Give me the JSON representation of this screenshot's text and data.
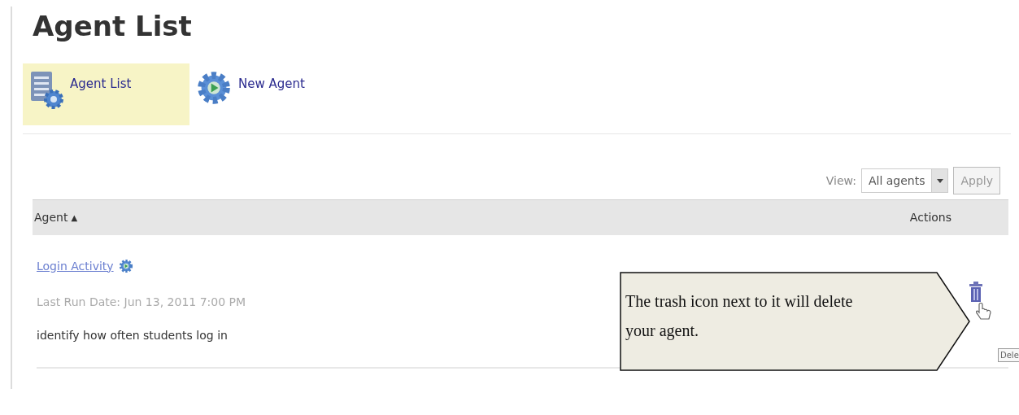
{
  "page_title": "Agent List",
  "tabs": [
    {
      "label": "Agent List",
      "kind": "list",
      "selected": true
    },
    {
      "label": "New Agent",
      "kind": "gear",
      "selected": false
    }
  ],
  "view_filter": {
    "label": "View:",
    "value": "All agents",
    "apply": "Apply"
  },
  "table": {
    "columns": [
      {
        "label": "Agent",
        "sort": "▲"
      },
      {
        "label": "Actions"
      }
    ],
    "rows": [
      {
        "name": "Login Activity",
        "last_run": "Last Run Date: Jun 13, 2011 7:00 PM",
        "description": "identify how often students log in"
      }
    ]
  },
  "callout": {
    "text": "The trash icon next to it will delete your agent."
  },
  "tooltip": {
    "text": "Dele"
  }
}
